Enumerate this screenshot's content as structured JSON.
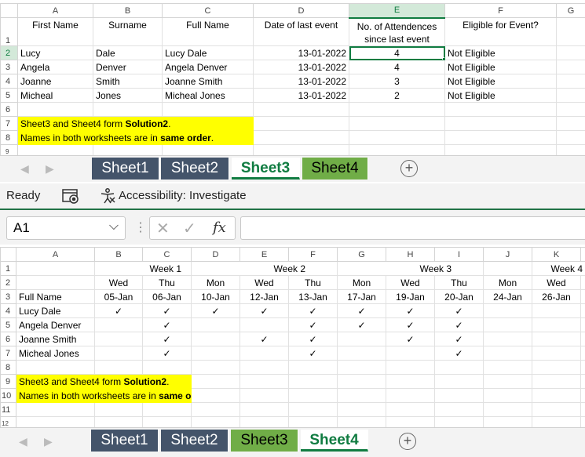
{
  "top": {
    "columns": [
      "A",
      "B",
      "C",
      "D",
      "E",
      "F",
      "G"
    ],
    "rows": [
      "1",
      "2",
      "3",
      "4",
      "5",
      "6",
      "7",
      "8",
      "9"
    ],
    "headers": [
      "First Name",
      "Surname",
      "Full Name",
      "Date of last event",
      "No. of Attendences since last event",
      "Eligible for Event?"
    ],
    "data": [
      [
        "Lucy",
        "Dale",
        "Lucy Dale",
        "13-01-2022",
        "4",
        "Not Eligible"
      ],
      [
        "Angela",
        "Denver",
        "Angela Denver",
        "13-01-2022",
        "4",
        "Not Eligible"
      ],
      [
        "Joanne",
        "Smith",
        "Joanne Smith",
        "13-01-2022",
        "3",
        "Not Eligible"
      ],
      [
        "Micheal",
        "Jones",
        "Micheal Jones",
        "13-01-2022",
        "2",
        "Not Eligible"
      ]
    ],
    "note1_pre": "Sheet3 and Sheet4 form ",
    "note1_bold": "Solution2",
    "note1_post": ".",
    "note2_pre": "Names in both worksheets are in ",
    "note2_bold": "same order",
    "note2_post": ".",
    "tabs": [
      "Sheet1",
      "Sheet2",
      "Sheet3",
      "Sheet4"
    ]
  },
  "status": {
    "ready": "Ready",
    "accessibility": "Accessibility: Investigate"
  },
  "formula_bar": {
    "name_box": "A1",
    "formula": ""
  },
  "bottom": {
    "columns": [
      "A",
      "B",
      "C",
      "D",
      "E",
      "F",
      "G",
      "H",
      "I",
      "J",
      "K"
    ],
    "rows": [
      "1",
      "2",
      "3",
      "4",
      "5",
      "6",
      "7",
      "8",
      "9",
      "10",
      "11",
      "12"
    ],
    "weeks": [
      "Week 1",
      "Week 2",
      "Week 3",
      "Week 4"
    ],
    "days": [
      "Wed",
      "Thu",
      "Mon",
      "Wed",
      "Thu",
      "Mon",
      "Wed",
      "Thu",
      "Mon",
      "Wed"
    ],
    "full_name_label": "Full Name",
    "dates": [
      "05-Jan",
      "06-Jan",
      "10-Jan",
      "12-Jan",
      "13-Jan",
      "17-Jan",
      "19-Jan",
      "20-Jan",
      "24-Jan",
      "26-Jan"
    ],
    "check": "✓",
    "people": [
      {
        "name": "Lucy Dale",
        "marks": [
          1,
          1,
          1,
          1,
          1,
          1,
          1,
          1,
          0,
          0
        ]
      },
      {
        "name": "Angela Denver",
        "marks": [
          0,
          1,
          0,
          0,
          1,
          1,
          1,
          1,
          0,
          0
        ]
      },
      {
        "name": "Joanne Smith",
        "marks": [
          0,
          1,
          0,
          1,
          1,
          0,
          1,
          1,
          0,
          0
        ]
      },
      {
        "name": "Micheal Jones",
        "marks": [
          0,
          1,
          0,
          0,
          1,
          0,
          0,
          1,
          0,
          0
        ]
      }
    ],
    "tabs": [
      "Sheet1",
      "Sheet2",
      "Sheet3",
      "Sheet4"
    ]
  }
}
